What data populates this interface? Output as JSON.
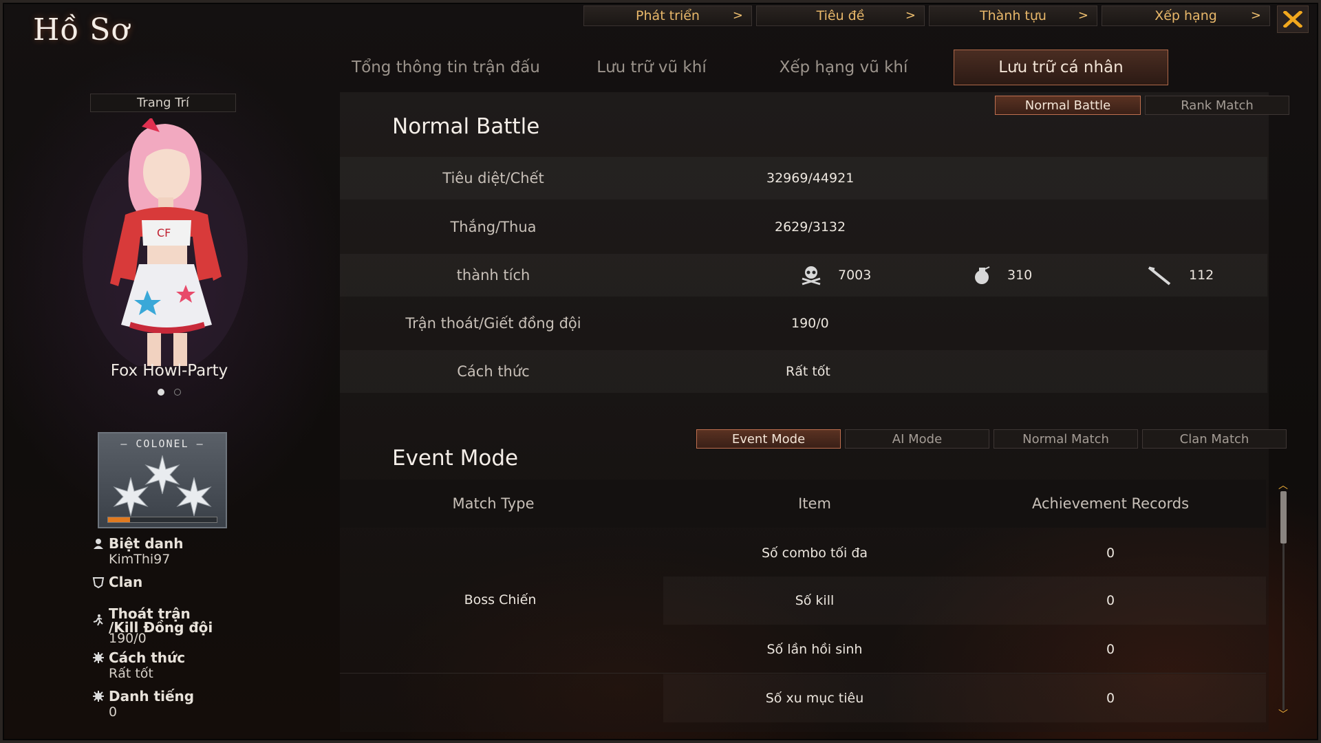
{
  "window": {
    "title": "Hồ Sơ"
  },
  "top_nav": [
    {
      "label": "Phát triển",
      "arrow": ">"
    },
    {
      "label": "Tiêu đề",
      "arrow": ">"
    },
    {
      "label": "Thành tựu",
      "arrow": ">"
    },
    {
      "label": "Xếp hạng",
      "arrow": ">"
    }
  ],
  "tabs": [
    {
      "label": "Tổng thông tin trận đấu",
      "active": false
    },
    {
      "label": "Lưu trữ vũ khí",
      "active": false
    },
    {
      "label": "Xếp hạng vũ khí",
      "active": false
    },
    {
      "label": "Lưu trữ cá nhân",
      "active": true
    }
  ],
  "left_panel": {
    "decoration_label": "Trang Trí",
    "character_name": "Fox Howl-Party",
    "page_dots": [
      true,
      false
    ],
    "rank_title": "COLONEL",
    "rank_progress": 0.2,
    "nickname_label": "Biệt danh",
    "nickname": "KimThi97",
    "clan_label": "Clan",
    "clan": "",
    "escape_label_1": "Thoát trận",
    "escape_label_2": "/Kill Đồng đội",
    "escape_value": "190/0",
    "style_label": "Cách thức",
    "style_value": "Rất tốt",
    "fame_label": "Danh tiếng",
    "fame_value": "0"
  },
  "battle_mode_toggle": [
    {
      "label": "Normal Battle",
      "active": true
    },
    {
      "label": "Rank Match",
      "active": false
    }
  ],
  "normal_battle": {
    "title": "Normal Battle",
    "rows": [
      {
        "label": "Tiêu diệt/Chết",
        "value": "32969/44921"
      },
      {
        "label": "Thắng/Thua",
        "value": "2629/3132"
      },
      {
        "label": "Trận thoát/Giết đồng đội",
        "value": "190/0"
      },
      {
        "label": "Cách thức",
        "value": "Rất tốt"
      }
    ],
    "achievement_label": "thành tích",
    "achievements": [
      {
        "icon": "skull-icon",
        "value": "7003"
      },
      {
        "icon": "grenade-icon",
        "value": "310"
      },
      {
        "icon": "knife-icon",
        "value": "112"
      }
    ]
  },
  "mode_tabs": [
    {
      "label": "Event Mode",
      "active": true
    },
    {
      "label": "AI Mode",
      "active": false
    },
    {
      "label": "Normal Match",
      "active": false
    },
    {
      "label": "Clan Match",
      "active": false
    }
  ],
  "event_mode": {
    "title": "Event Mode",
    "columns": [
      "Match Type",
      "Item",
      "Achievement Records"
    ],
    "group": "Boss Chiến",
    "rows": [
      {
        "item": "Số combo tối đa",
        "record": "0"
      },
      {
        "item": "Số kill",
        "record": "0"
      },
      {
        "item": "Số lần hồi sinh",
        "record": "0"
      },
      {
        "item": "Số xu mục tiêu",
        "record": "0"
      }
    ]
  },
  "colors": {
    "accent": "#e9b86a",
    "active_tab_border": "#b0694a",
    "close_x": "#f2a81e"
  }
}
